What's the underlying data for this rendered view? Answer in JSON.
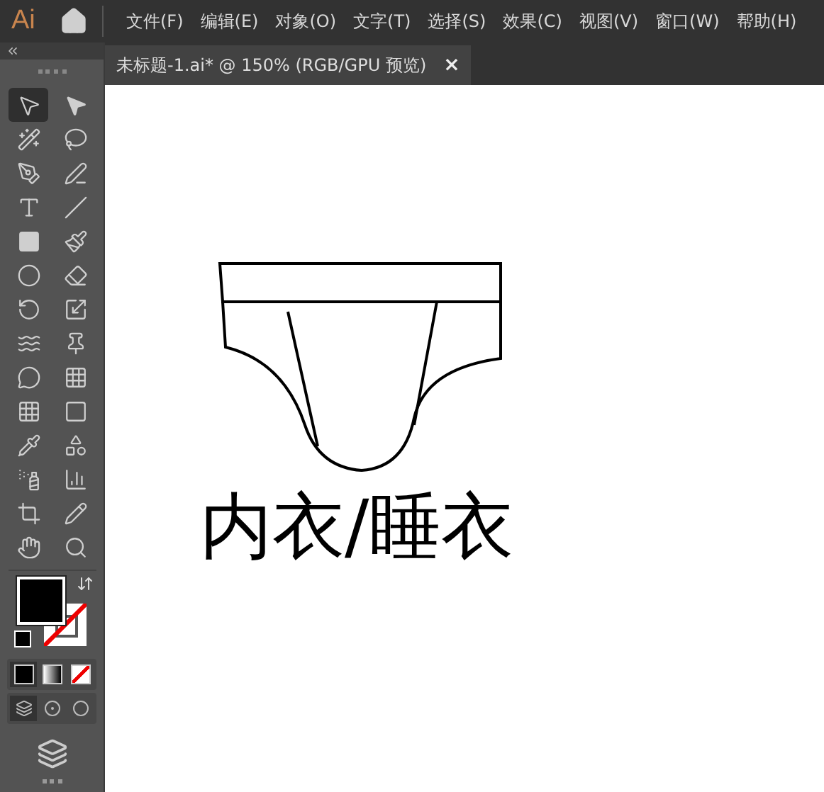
{
  "app": {
    "logo": "Ai"
  },
  "menu": [
    "文件(F)",
    "编辑(E)",
    "对象(O)",
    "文字(T)",
    "选择(S)",
    "效果(C)",
    "视图(V)",
    "窗口(W)",
    "帮助(H)"
  ],
  "tabs": [
    {
      "label": "未标题-1.ai* @ 150% (RGB/GPU 预览)",
      "close": "×"
    }
  ],
  "toolbox": {
    "tools": [
      {
        "selected": true
      },
      {
        "selected": false
      },
      {
        "selected": false
      },
      {
        "selected": false
      },
      {
        "selected": false
      },
      {
        "selected": false
      },
      {
        "selected": false
      },
      {
        "selected": false
      },
      {
        "selected": false
      },
      {
        "selected": false
      },
      {
        "selected": false
      },
      {
        "selected": false
      },
      {
        "selected": false
      },
      {
        "selected": false
      },
      {
        "selected": false
      },
      {
        "selected": false
      },
      {
        "selected": false
      },
      {
        "selected": false
      },
      {
        "selected": false
      },
      {
        "selected": false
      },
      {
        "selected": false
      },
      {
        "selected": false
      },
      {
        "selected": false
      },
      {
        "selected": false
      },
      {
        "selected": false
      },
      {
        "selected": false
      },
      {
        "selected": false
      },
      {
        "selected": false
      }
    ],
    "stroke_none": true,
    "color_modes": [
      {
        "selected": true
      },
      {
        "selected": false
      },
      {
        "selected": false
      }
    ],
    "draw_modes": [
      {
        "selected": true
      },
      {
        "selected": false
      },
      {
        "selected": false
      }
    ]
  },
  "canvas": {
    "caption": "内衣/睡衣"
  }
}
